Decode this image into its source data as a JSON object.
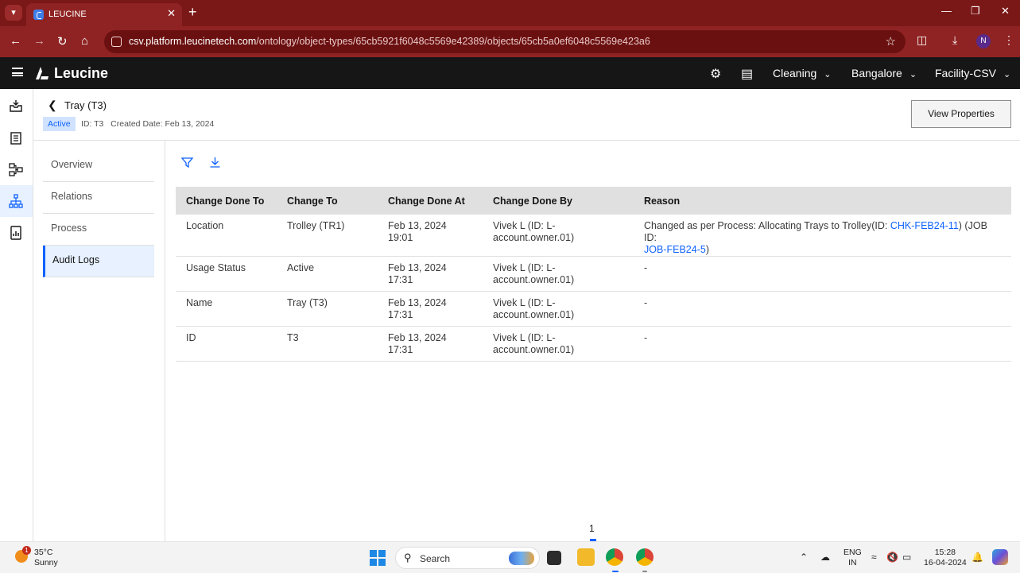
{
  "browser": {
    "tab_title": "LEUCINE",
    "url_host": "csv.platform.leucinetech.com",
    "url_path": "/ontology/object-types/65cb5921f6048c5569e42389/objects/65cb5a0ef6048c5569e423a6",
    "profile_initial": "N"
  },
  "app": {
    "brand": "Leucine",
    "use_case": "Cleaning",
    "location": "Bangalore",
    "facility": "Facility-CSV"
  },
  "object": {
    "title": "Tray (T3)",
    "status": "Active",
    "id_label": "ID: T3",
    "created_label": "Created Date: Feb 13, 2024",
    "view_properties_label": "View Properties"
  },
  "subnav": {
    "items": [
      {
        "label": "Overview"
      },
      {
        "label": "Relations"
      },
      {
        "label": "Process"
      },
      {
        "label": "Audit Logs"
      }
    ],
    "active": "Audit Logs"
  },
  "audit_table": {
    "headers": [
      "Change Done To",
      "Change To",
      "Change Done At",
      "Change Done By",
      "Reason"
    ],
    "rows": [
      {
        "field": "Location",
        "to": "Trolley (TR1)",
        "date": "Feb 13, 2024",
        "time": "19:01",
        "by_line1": "Vivek L (ID: L-",
        "by_line2": "account.owner.01)",
        "reason_prefix": "Changed as per Process: Allocating Trays to Trolley(ID: ",
        "reason_link1": "CHK-FEB24-11",
        "reason_mid": ") (JOB ID:",
        "reason_link2": "JOB-FEB24-5",
        "reason_suffix": ")"
      },
      {
        "field": "Usage Status",
        "to": "Active",
        "date": "Feb 13, 2024",
        "time": "17:31",
        "by_line1": "Vivek L (ID: L-",
        "by_line2": "account.owner.01)",
        "reason": "-"
      },
      {
        "field": "Name",
        "to": "Tray (T3)",
        "date": "Feb 13, 2024",
        "time": "17:31",
        "by_line1": "Vivek L (ID: L-",
        "by_line2": "account.owner.01)",
        "reason": "-"
      },
      {
        "field": "ID",
        "to": "T3",
        "date": "Feb 13, 2024",
        "time": "17:31",
        "by_line1": "Vivek L (ID: L-",
        "by_line2": "account.owner.01)",
        "reason": "-"
      }
    ]
  },
  "pagination": {
    "current_page": "1"
  },
  "taskbar": {
    "weather_badge": "1",
    "temperature": "35°C",
    "condition": "Sunny",
    "search_placeholder": "Search",
    "lang_line1": "ENG",
    "lang_line2": "IN",
    "time": "15:28",
    "date": "16-04-2024"
  },
  "colors": {
    "browser_frame": "#8f2323",
    "app_header": "#161616",
    "accent": "#0f62fe",
    "active_bg": "#e7f1ff"
  }
}
